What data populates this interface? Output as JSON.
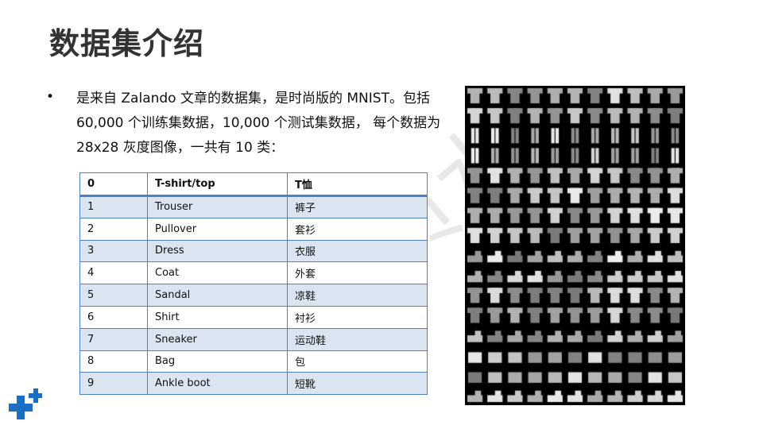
{
  "title": "数据集介绍",
  "bullet_symbol": "•",
  "paragraph": "是来自 Zalando 文章的数据集，是时尚版的 MNIST。包括 60,000 个训练集数据，10,000 个测试集数据， 每个数据为 28x28 灰度图像，一共有 10 类：",
  "table": {
    "rows": [
      [
        "0",
        "T-shirt/top",
        "T恤"
      ],
      [
        "1",
        "Trouser",
        "裤子"
      ],
      [
        "2",
        "Pullover",
        "套衫"
      ],
      [
        "3",
        "Dress",
        "衣服"
      ],
      [
        "4",
        "Coat",
        "外套"
      ],
      [
        "5",
        "Sandal",
        "凉鞋"
      ],
      [
        "6",
        "Shirt",
        "衬衫"
      ],
      [
        "7",
        "Sneaker",
        "运动鞋"
      ],
      [
        "8",
        "Bag",
        "包"
      ],
      [
        "9",
        "Ankle boot",
        "短靴"
      ]
    ]
  },
  "watermark": "非会员水",
  "colors": {
    "table_border": "#4f81bd",
    "row_band": "#dbe5f1",
    "logo": "#1a6fc4",
    "title": "#333333"
  },
  "image": {
    "description_icon": "fashion-mnist-sample-grid"
  }
}
